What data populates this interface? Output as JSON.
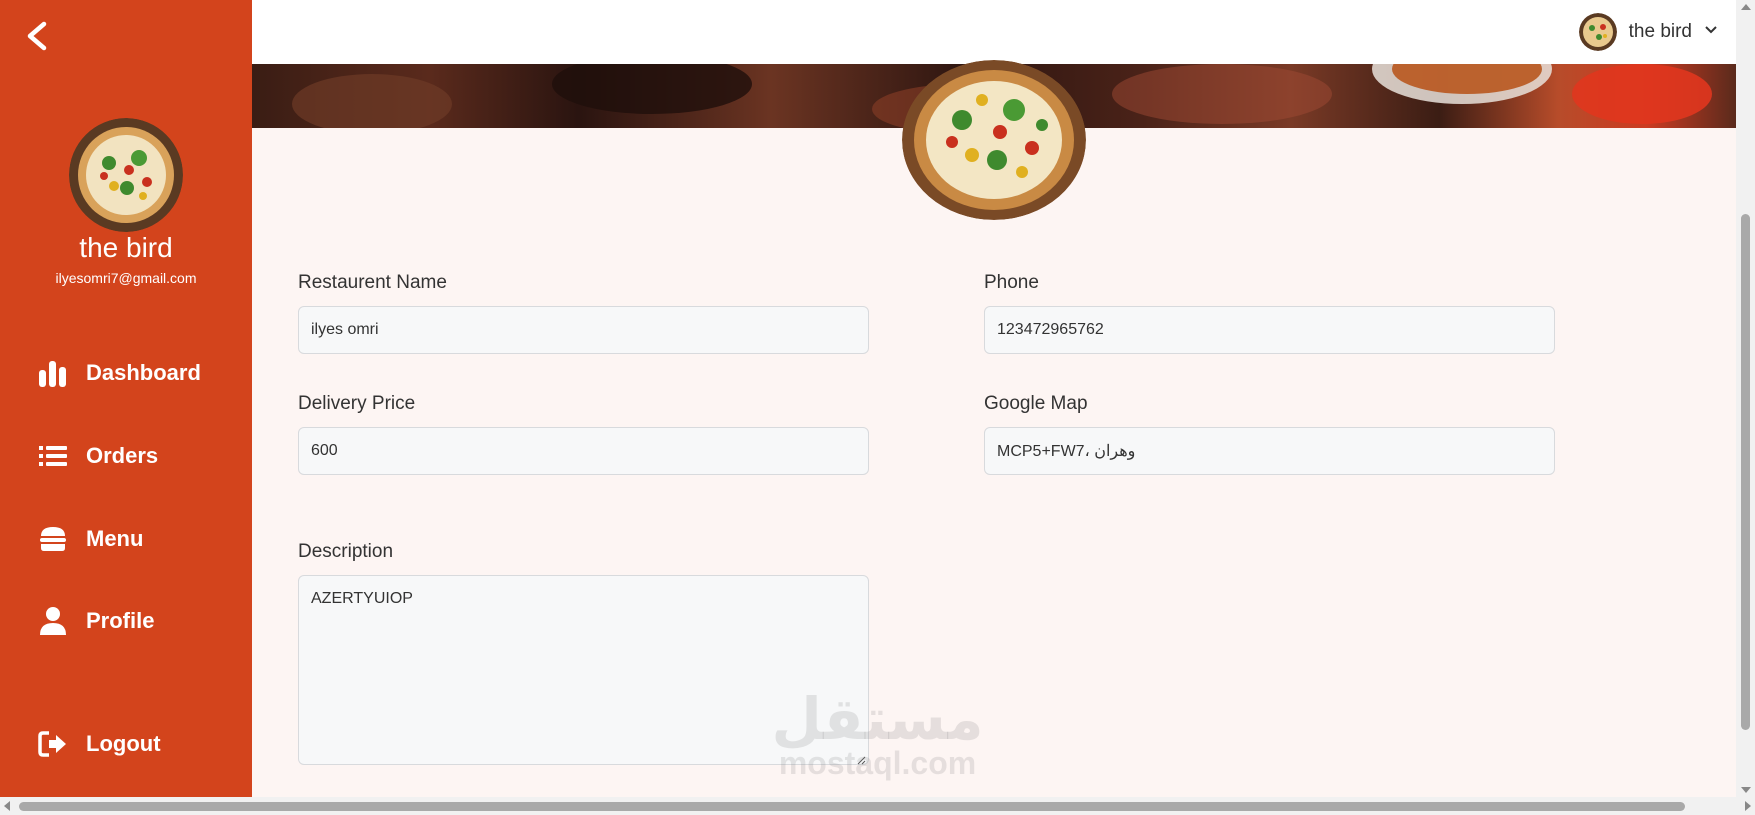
{
  "sidebar": {
    "name": "the bird",
    "email": "ilyesomri7@gmail.com",
    "items": [
      {
        "label": "Dashboard",
        "icon": "bar-chart-icon"
      },
      {
        "label": "Orders",
        "icon": "list-icon"
      },
      {
        "label": "Menu",
        "icon": "burger-icon"
      },
      {
        "label": "Profile",
        "icon": "user-icon"
      }
    ],
    "logout_label": "Logout"
  },
  "header": {
    "user_name": "the bird"
  },
  "form": {
    "restaurant_name": {
      "label": "Restaurent Name",
      "value": "ilyes omri"
    },
    "phone": {
      "label": "Phone",
      "value": "123472965762"
    },
    "delivery_price": {
      "label": "Delivery Price",
      "value": "600"
    },
    "google_map": {
      "label": "Google Map",
      "value": "MCP5+FW7، وهران"
    },
    "description": {
      "label": "Description",
      "value": "AZERTYUIOP"
    }
  },
  "watermark": {
    "arabic": "مستقل",
    "latin": "mostaql.com"
  },
  "colors": {
    "sidebar_bg": "#d3441c",
    "page_bg": "#fdf5f3"
  }
}
